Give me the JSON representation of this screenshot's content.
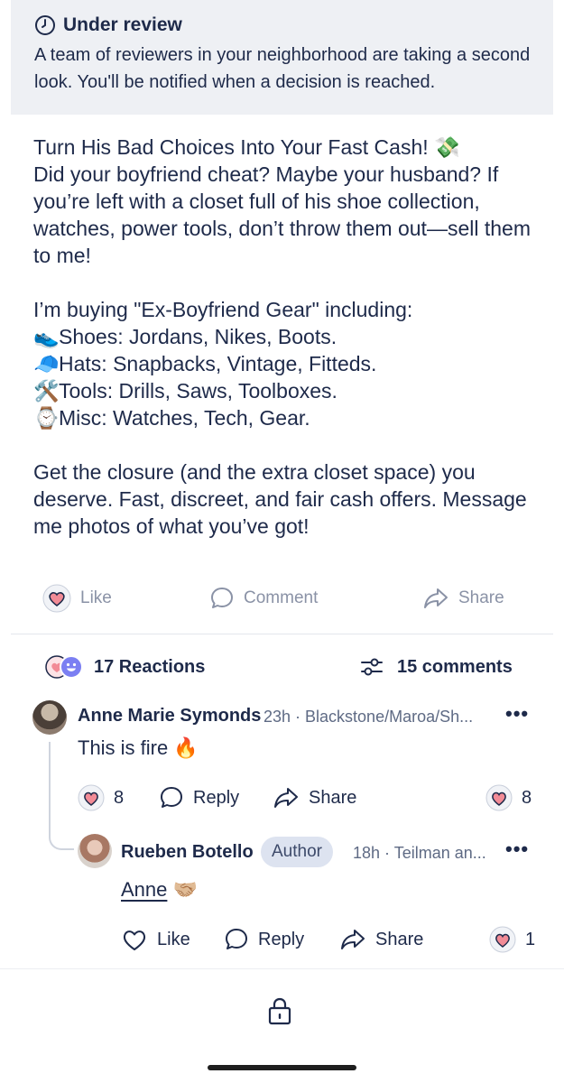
{
  "banner": {
    "title": "Under review",
    "text": "A team of reviewers in your neighborhood are taking a second look. You'll be notified when a decision is reached."
  },
  "post": {
    "line1": "Turn His Bad Choices Into Your Fast Cash! 💸",
    "line2": "Did your boyfriend cheat? Maybe your husband? If you’re left with a closet full of his shoe collection, watches, power tools, don’t throw them out—sell them to me!",
    "intro": "I’m buying \"Ex-Boyfriend Gear\" including:",
    "items": [
      {
        "emoji": "👟",
        "text": "Shoes: Jordans, Nikes, Boots."
      },
      {
        "emoji": "🧢",
        "text": "Hats: Snapbacks, Vintage, Fitteds."
      },
      {
        "emoji": "🛠️",
        "text": "Tools: Drills, Saws, Toolboxes."
      },
      {
        "emoji": "⌚",
        "text": "Misc: Watches, Tech, Gear."
      }
    ],
    "closing": "Get the closure (and the extra closet space) you deserve. Fast, discreet, and fair cash offers. Message me photos of what you’ve got!"
  },
  "actions": {
    "like": "Like",
    "comment": "Comment",
    "share": "Share"
  },
  "stats": {
    "reactions": "17 Reactions",
    "comments": "15 comments"
  },
  "comments": [
    {
      "name": "Anne Marie Symonds",
      "meta": "23h · Blackstone/Maroa/Sh...",
      "text": "This is fire 🔥",
      "like_count": "8",
      "reply_label": "Reply",
      "share_label": "Share",
      "reaction_count": "8"
    },
    {
      "name": "Rueben Botello",
      "badge": "Author",
      "meta": "18h · Teilman an...",
      "mention": "Anne",
      "text_suffix": " 🤝🏼",
      "like_label": "Like",
      "reply_label": "Reply",
      "share_label": "Share",
      "reaction_count": "1"
    }
  ],
  "colors": {
    "text": "#1e2a4a",
    "muted": "#8a92a6",
    "heart": "#f28b96",
    "banner_bg": "#eef0f4",
    "badge_bg": "#dde3f0"
  },
  "icons": [
    "clock-icon",
    "heart-icon",
    "comment-icon",
    "share-icon",
    "reaction-heart-icon",
    "reaction-laugh-icon",
    "filter-icon",
    "more-dots-icon",
    "lock-icon"
  ]
}
